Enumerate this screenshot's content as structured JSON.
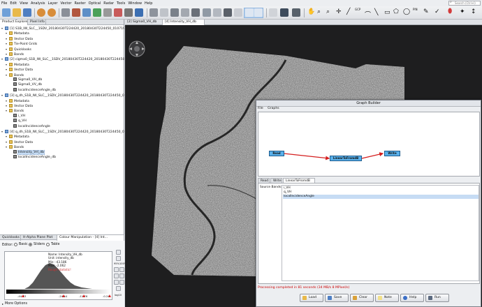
{
  "menu": [
    "File",
    "Edit",
    "View",
    "Analysis",
    "Layer",
    "Vector",
    "Raster",
    "Optical",
    "Radar",
    "Tools",
    "Window",
    "Help"
  ],
  "search_placeholder": "Search (Ctrl+I)",
  "toolbar_labels": {
    "gcp": "GCP",
    "pin": "PIN"
  },
  "left_tabs": [
    "Product Explorer",
    "Pixel Info"
  ],
  "tree": [
    {
      "label": "[1] S1B_IW_SLC__1SDV_20180430T224420_20180430T224450_010719_...",
      "level": 0,
      "icon": "prod"
    },
    {
      "label": "Metadata",
      "level": 1,
      "icon": "folder"
    },
    {
      "label": "Vector Data",
      "level": 1,
      "icon": "folder"
    },
    {
      "label": "Tie-Point Grids",
      "level": 1,
      "icon": "folder"
    },
    {
      "label": "Quicklooks",
      "level": 1,
      "icon": "folder"
    },
    {
      "label": "Bands",
      "level": 1,
      "icon": "folder"
    },
    {
      "label": "[2] cigma0_S1B_IW_SLC__1SDV_20180430T224420_20180430T224450...",
      "level": 0,
      "icon": "prod"
    },
    {
      "label": "Metadata",
      "level": 1,
      "icon": "folder"
    },
    {
      "label": "Vector Data",
      "level": 1,
      "icon": "folder"
    },
    {
      "label": "Bands",
      "level": 1,
      "icon": "folder"
    },
    {
      "label": "Sigma0_VH_db",
      "level": 2,
      "icon": "band"
    },
    {
      "label": "Sigma0_VV_db",
      "level": 2,
      "icon": "band"
    },
    {
      "label": "localIncidenceAngle_db",
      "level": 2,
      "icon": "band"
    },
    {
      "label": "[3] q_dh_S1B_IW_SLC__1SDV_20180430T224420_20180430T224450_0...",
      "level": 0,
      "icon": "prod"
    },
    {
      "label": "Metadata",
      "level": 1,
      "icon": "folder"
    },
    {
      "label": "Vector Data",
      "level": 1,
      "icon": "folder"
    },
    {
      "label": "Bands",
      "level": 1,
      "icon": "folder"
    },
    {
      "label": "i_VH",
      "level": 2,
      "icon": "band"
    },
    {
      "label": "q_VH",
      "level": 2,
      "icon": "band"
    },
    {
      "label": "localIncidenceAngle",
      "level": 2,
      "icon": "band"
    },
    {
      "label": "[4] q_dh_S1B_IW_SLC__1SDV_20180430T224420_20180430T224450_0...",
      "level": 0,
      "icon": "prod"
    },
    {
      "label": "Metadata",
      "level": 1,
      "icon": "folder"
    },
    {
      "label": "Vector Data",
      "level": 1,
      "icon": "folder"
    },
    {
      "label": "Bands",
      "level": 1,
      "icon": "folder"
    },
    {
      "label": "Intensity_VH_db",
      "level": 2,
      "icon": "band",
      "selected": true
    },
    {
      "label": "localIncidenceAngle_db",
      "level": 2,
      "icon": "band"
    }
  ],
  "bottom_tabs": [
    "Quicklooks",
    "H-Alpha Plane Plot",
    "Colour Manipulation - [4] Int..."
  ],
  "editor": {
    "label": "Editor:",
    "options": [
      "Basic",
      "Sliders",
      "Table"
    ],
    "selected": "Sliders"
  },
  "histogram": {
    "info": [
      "Name: Intensity_VH_db",
      "Unit: intensity_db",
      "Min: -43.186",
      "Max: -2.062",
      "Rough statistic!"
    ],
    "slider_values": [
      "-44.73",
      "-24.44",
      "-11.76",
      "-0.24"
    ],
    "side_labels": {
      "zoom_v": "95%",
      "zoom_h": "100%",
      "log": "log10"
    }
  },
  "more_options": "More Options",
  "workspace_tabs": [
    "[2] Sigma0_VH_db",
    "[4] Intensity_VH_db"
  ],
  "graph_builder": {
    "title": "Graph Builder",
    "menu": [
      "File",
      "Graphs"
    ],
    "nodes": [
      "Read",
      "LinearToFromdB",
      "Write"
    ],
    "tabs": [
      "Read",
      "Write",
      "LinearToFromdB"
    ],
    "active_tab": "LinearToFromdB",
    "source_bands_label": "Source Bands:",
    "source_bands": [
      "i_VH",
      "q_VH",
      "localIncidenceAngle"
    ],
    "selected_band": "localIncidenceAngle",
    "status": "Processing completed in 81 seconds (34 MB/s 8 MPixel/s)",
    "buttons": [
      "Load",
      "Save",
      "Clear",
      "Note",
      "Help",
      "Run"
    ]
  }
}
